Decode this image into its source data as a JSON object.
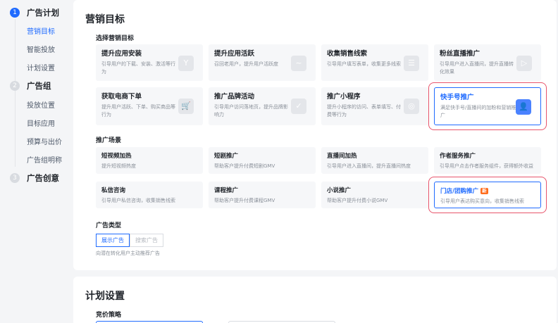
{
  "sidebar": {
    "steps": [
      {
        "num": "1",
        "label": "广告计划",
        "subs": [
          "营销目标",
          "智能投放",
          "计划设置"
        ]
      },
      {
        "num": "2",
        "label": "广告组",
        "subs": [
          "投放位置",
          "目标应用",
          "预算与出价",
          "广告组明称"
        ]
      },
      {
        "num": "3",
        "label": "广告创意"
      }
    ]
  },
  "marketing": {
    "title": "营销目标",
    "select_label": "选择营销目标",
    "goals": [
      {
        "title": "提升应用安装",
        "desc": "引导用户的下载、安装、激活等行为",
        "icon": "Y"
      },
      {
        "title": "提升应用活跃",
        "desc": "召回老用户，提升用户活跃度",
        "icon": "~"
      },
      {
        "title": "收集销售线索",
        "desc": "引导用户填写表单，收集更多线索",
        "icon": "☰"
      },
      {
        "title": "粉丝直播推广",
        "desc": "引导用户进入直播间，提升直播转化效果",
        "icon": "▷"
      },
      {
        "title": "获取电商下单",
        "desc": "提升用户活跃、下单、购买商品等行为",
        "icon": "🛒"
      },
      {
        "title": "推广品牌活动",
        "desc": "引导用户访问落地页，提升品牌影响力",
        "icon": "✓"
      },
      {
        "title": "推广小程序",
        "desc": "提升小程序的访问、表单填写、付费等行为",
        "icon": "◎"
      },
      {
        "title": "快手号推广",
        "desc": "满足快手号/直播间的加粉和营销推广",
        "icon": "👤"
      }
    ],
    "scene_label": "推广场景",
    "scenes": [
      {
        "title": "短视频加热",
        "desc": "提升短视频热度"
      },
      {
        "title": "短剧推广",
        "desc": "帮助客户提升付费短剧GMV"
      },
      {
        "title": "直播间加热",
        "desc": "引导用户进入直播间，提升直播间热度"
      },
      {
        "title": "作者服务推广",
        "desc": "引导用户点击作者服务组件，获得额外收益"
      },
      {
        "title": "私信咨询",
        "desc": "引导用户私信咨询，收集销售线索"
      },
      {
        "title": "课程推广",
        "desc": "帮助客户提升付费课程GMV"
      },
      {
        "title": "小说推广",
        "desc": "帮助客户提升付费小说GMV"
      },
      {
        "title": "门店/团购推广",
        "desc": "引导用户表达购买意向，收集销售线索",
        "badge": "新"
      }
    ],
    "adtype_label": "广告类型",
    "adtype_options": [
      "展示广告",
      "搜索广告"
    ],
    "adtype_hint": "向潜在转化用户主动推荐广告"
  },
  "plan": {
    "title": "计划设置",
    "bid_label": "竞价策略"
  },
  "colors": {
    "accent": "#1f6bff",
    "highlight": "#e8546b",
    "badge": "#ff6b1a"
  }
}
